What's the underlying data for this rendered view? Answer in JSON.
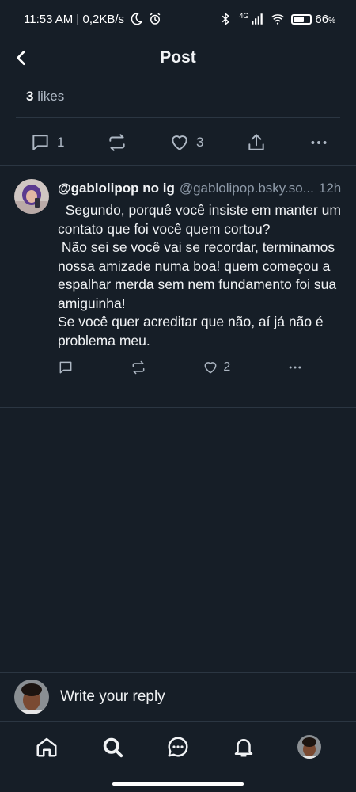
{
  "status_bar": {
    "time_speed": "11:53 AM | 0,2KB/s",
    "battery_percent": "66",
    "battery_level": 0.66,
    "network": "4G"
  },
  "header": {
    "title": "Post"
  },
  "main_post": {
    "likes_count": "3",
    "likes_label": "likes",
    "reply_count": "1",
    "like_count": "3"
  },
  "reply": {
    "display_name": "@gablolipop no ig",
    "handle": "@gablolipop.bsky.so...",
    "time": "12h",
    "text": "  Segundo, porquê você insiste em manter um contato que foi você quem cortou?\n Não sei se você vai se recordar, terminamos nossa amizade numa boa! quem começou a espalhar merda sem nem fundamento foi sua amiguinha!\nSe você quer acreditar que não, aí já não é problema meu.",
    "like_count": "2"
  },
  "composer": {
    "placeholder": "Write your reply"
  },
  "colors": {
    "background": "#161e27",
    "divider": "#2b3642",
    "muted_text": "#8e9aa8",
    "icon": "#aeb8c4"
  }
}
